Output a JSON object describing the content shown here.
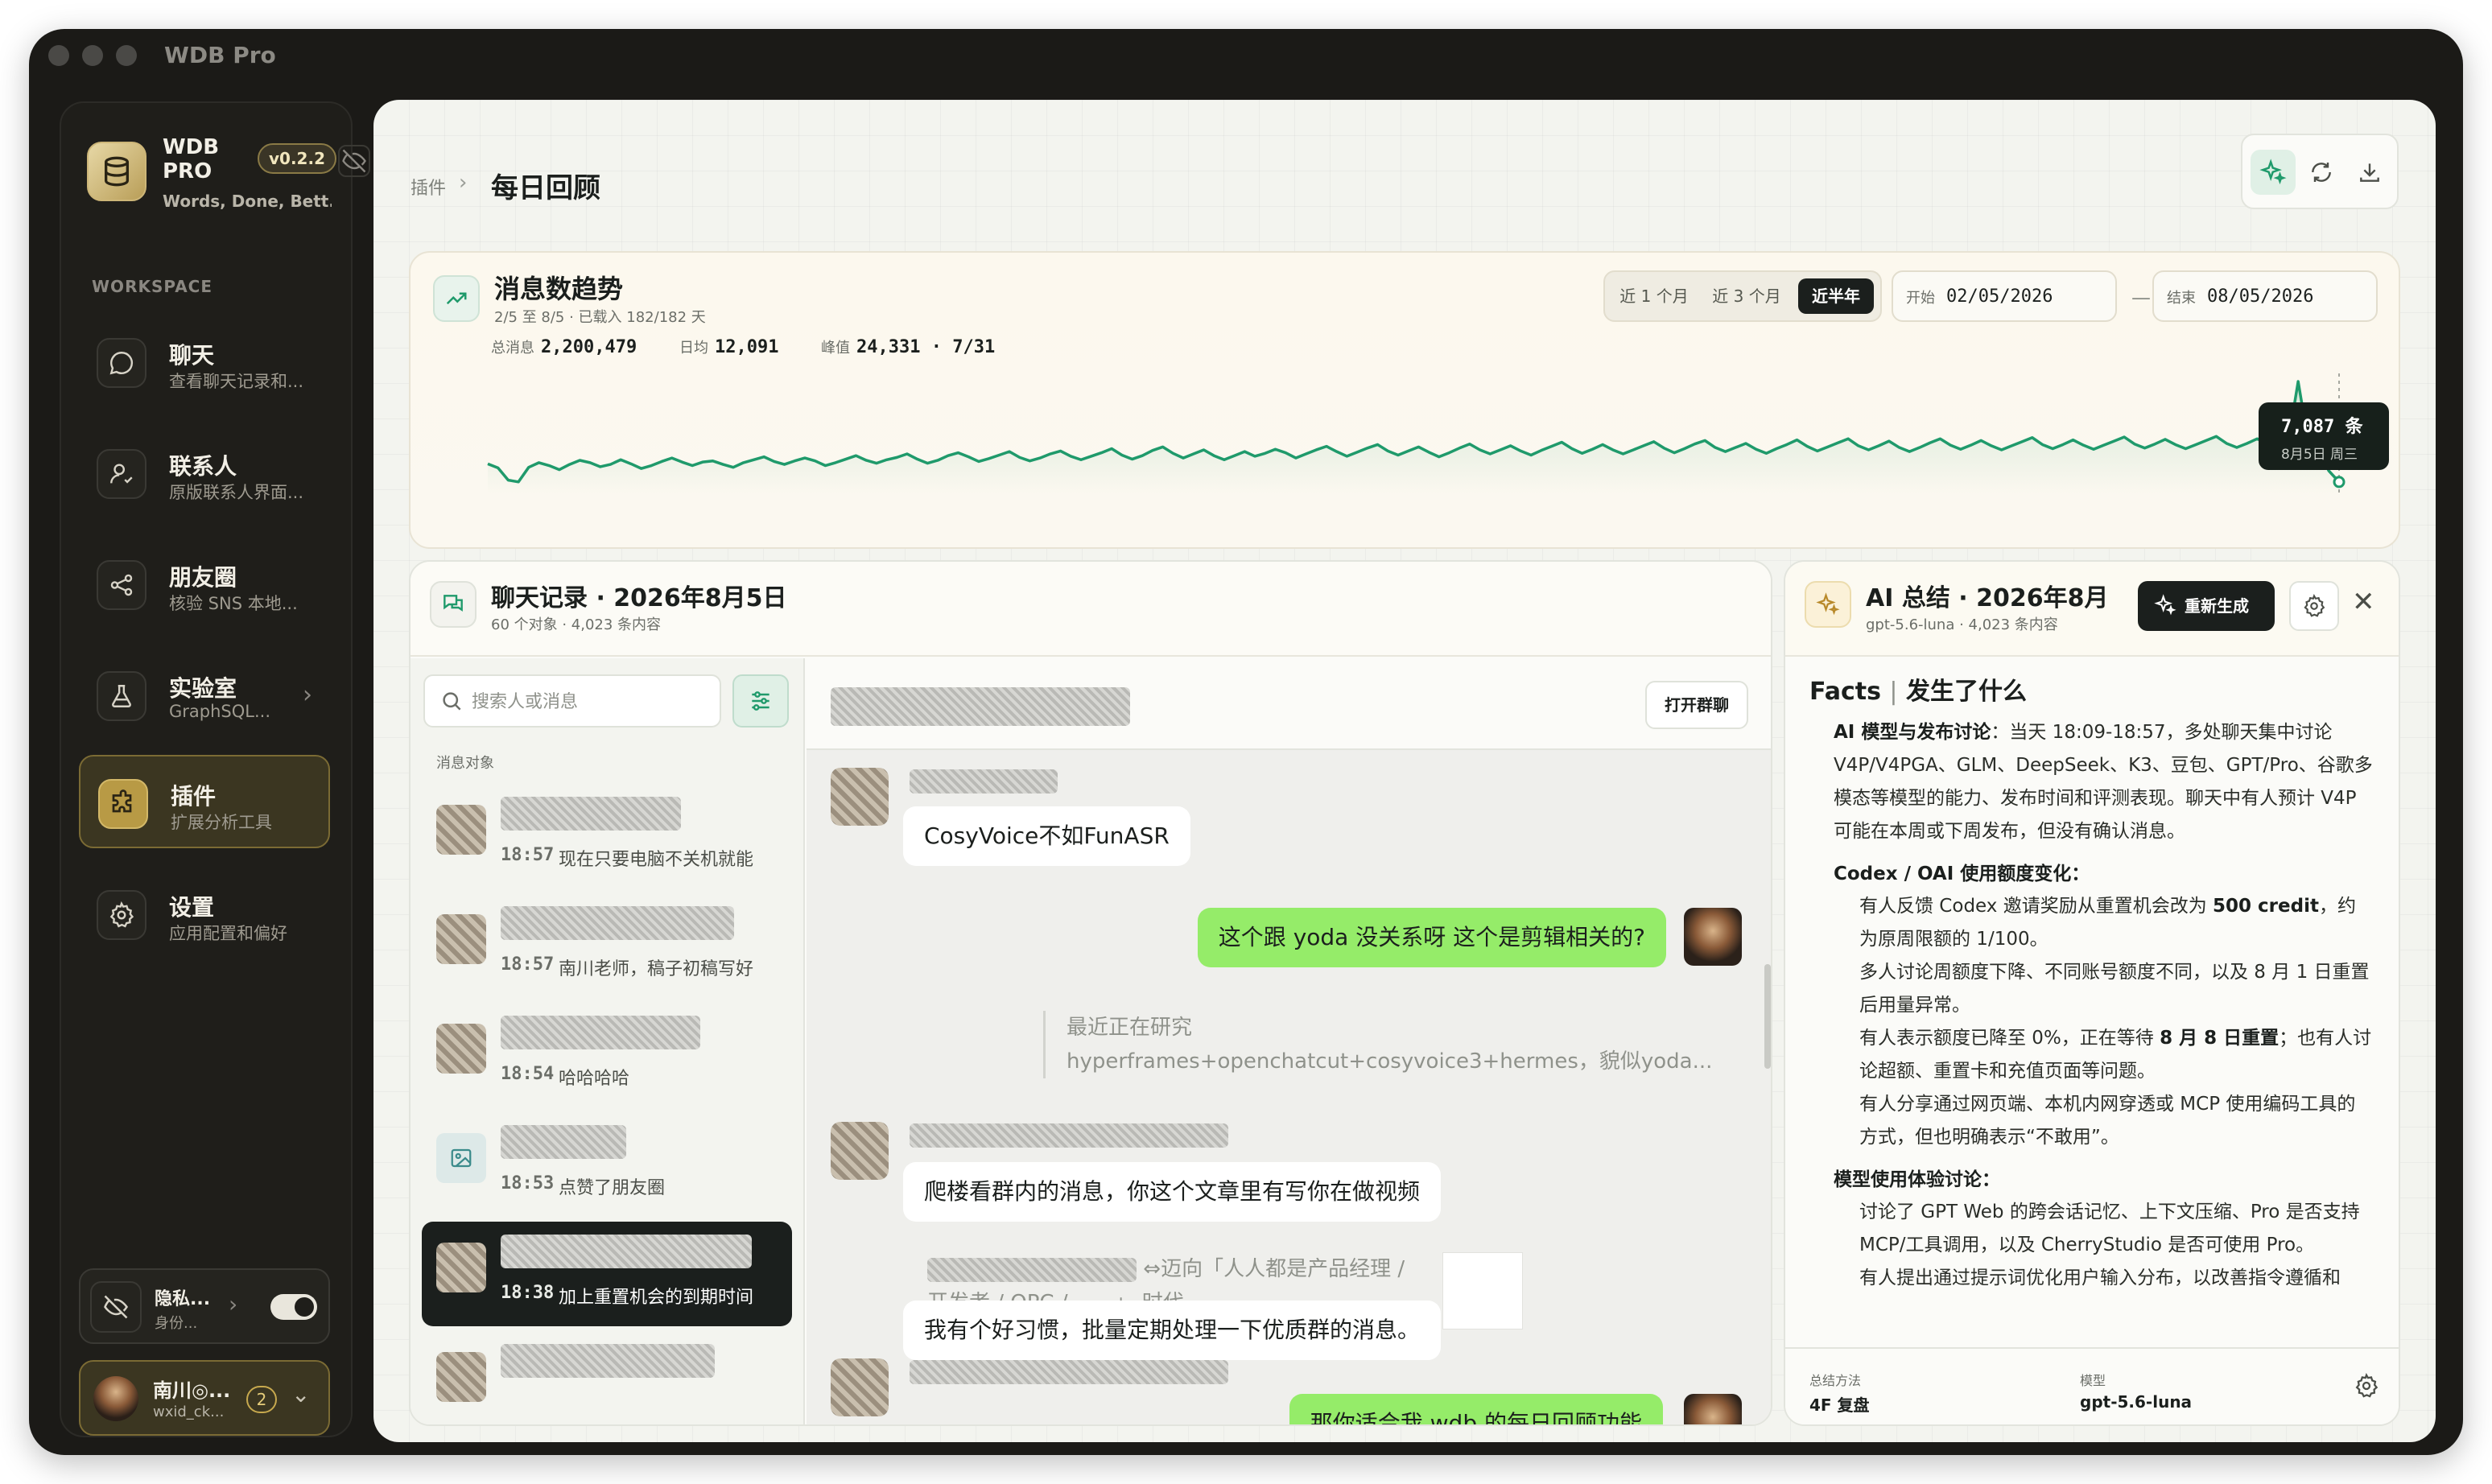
{
  "window": {
    "title": "WDB Pro"
  },
  "brand": {
    "name": "WDB PRO",
    "version": "v0.2.2",
    "slogan": "Words, Done, Bett..."
  },
  "sidebar": {
    "section_label": "WORKSPACE",
    "items": [
      {
        "title": "聊天",
        "subtitle": "查看聊天记录和...",
        "icon": "chat-icon"
      },
      {
        "title": "联系人",
        "subtitle": "原版联系人界面...",
        "icon": "user-icon"
      },
      {
        "title": "朋友圈",
        "subtitle": "核验 SNS 本地...",
        "icon": "share-icon"
      },
      {
        "title": "实验室",
        "subtitle": "GraphSQL...",
        "icon": "flask-icon"
      },
      {
        "title": "插件",
        "subtitle": "扩展分析工具",
        "icon": "puzzle-icon"
      },
      {
        "title": "设置",
        "subtitle": "应用配置和偏好",
        "icon": "gear-icon"
      }
    ],
    "privacy": {
      "title": "隐私...",
      "subtitle": "身份..."
    },
    "account": {
      "name": "南川◎...",
      "id": "wxid_ck...",
      "badge": "2"
    }
  },
  "breadcrumb": {
    "parent": "插件",
    "current": "每日回顾"
  },
  "trend": {
    "title": "消息数趋势",
    "subtitle": "2/5 至 8/5 · 已载入 182/182 天",
    "stats": [
      {
        "label": "总消息",
        "value": "2,200,479"
      },
      {
        "label": "日均",
        "value": "12,091"
      },
      {
        "label": "峰值",
        "value": "24,331 · 7/31"
      }
    ],
    "ranges": [
      "近 1 个月",
      "近 3 个月",
      "近半年"
    ],
    "range_active": "近半年",
    "start_label": "开始",
    "start_value": "02/05/2026",
    "end_label": "结束",
    "end_value": "08/05/2026",
    "tooltip_value": "7,087 条",
    "tooltip_date": "8月5日 周三"
  },
  "chart_data": {
    "type": "line",
    "title": "消息数趋势",
    "x_start": "2026-02-05",
    "x_end": "2026-08-05",
    "color": "#1f9a6b",
    "values": [
      10200,
      9500,
      7400,
      7100,
      9600,
      10400,
      9900,
      9200,
      10100,
      10800,
      10400,
      9700,
      10100,
      10900,
      10200,
      9400,
      9900,
      10600,
      11200,
      10500,
      9900,
      10500,
      10700,
      10100,
      9600,
      10400,
      10900,
      11400,
      10600,
      10100,
      10700,
      11200,
      10700,
      9900,
      10400,
      11000,
      11600,
      10800,
      10300,
      10900,
      11300,
      11900,
      11000,
      10300,
      10800,
      11600,
      12100,
      11400,
      10600,
      11100,
      11700,
      12300,
      11300,
      10700,
      11200,
      11900,
      12400,
      11500,
      10900,
      11500,
      12100,
      12800,
      11700,
      11000,
      11600,
      12500,
      13100,
      12000,
      11200,
      11900,
      12600,
      11600,
      10900,
      11600,
      12300,
      11500,
      12000,
      12700,
      12100,
      11200,
      11900,
      12600,
      13200,
      12300,
      11500,
      12200,
      12900,
      13500,
      12400,
      11700,
      12400,
      13100,
      12200,
      11400,
      12100,
      12900,
      13600,
      12600,
      11900,
      12600,
      13300,
      12400,
      11700,
      12500,
      13200,
      13900,
      12800,
      12000,
      12700,
      13500,
      12600,
      11900,
      12600,
      13300,
      14000,
      12900,
      12100,
      12800,
      13600,
      14200,
      13000,
      12300,
      13000,
      13700,
      12700,
      12000,
      12800,
      13500,
      14300,
      13200,
      12400,
      13100,
      13800,
      14500,
      13300,
      12600,
      13300,
      14100,
      13000,
      12300,
      13000,
      13800,
      14500,
      13400,
      12700,
      13400,
      14200,
      13300,
      12600,
      13300,
      14000,
      14700,
      13500,
      12800,
      13500,
      14300,
      13400,
      12700,
      13400,
      14100,
      14800,
      13600,
      12900,
      13600,
      14400,
      13500,
      12800,
      13500,
      14200,
      14900,
      13700,
      13000,
      13700,
      14500,
      13600,
      12900,
      13600,
      24331,
      13800,
      12500,
      9000,
      7087
    ]
  },
  "chat": {
    "title": "聊天记录 · 2026年8月5日",
    "subtitle": "60 个对象 · 4,023 条内容",
    "search_placeholder": "搜索人或消息",
    "list_label": "消息对象",
    "open_group": "打开群聊",
    "conversations": [
      {
        "time": "18:57",
        "preview": "现在只要电脑不关机就能"
      },
      {
        "time": "18:57",
        "preview": "南川老师，稿子初稿写好"
      },
      {
        "time": "18:54",
        "preview": "哈哈哈哈"
      },
      {
        "time": "18:53",
        "preview": "点赞了朋友圈"
      },
      {
        "time": "18:38",
        "preview": "加上重置机会的到期时间"
      }
    ],
    "messages": {
      "m1": "CosyVoice不如FunASR",
      "m2": "这个跟 yoda 没关系呀 这个是剪辑相关的?",
      "q1": "最近正在研究",
      "q2": "hyperframes+openchatcut+cosyvoice3+hermes，貌似yoda...",
      "m3": "爬楼看群内的消息，你这个文章里有写你在做视频",
      "link1": "迈向「人人都是产品经理 /",
      "link2": "开发者 / OPC / ......」 时代",
      "m4": "我有个好习惯，批量定期处理一下优质群的消息。",
      "m5": "那你适合我 wdb 的每日回顾功能"
    }
  },
  "ai": {
    "title": "AI 总结 · 2026年8月...",
    "subtitle": "gpt-5.6-luna · 4,023 条内容",
    "regen": "重新生成",
    "facts_title": "Facts",
    "facts_sub": "发生了什么",
    "s1_title": "AI 模型与发布讨论",
    "s1_text": "：当天 18:09-18:57，多处聊天集中讨论 V4P/V4PGA、GLM、DeepSeek、K3、豆包、GPT/Pro、谷歌多模态等模型的能力、发布时间和评测表现。聊天中有人预计 V4P 可能在本周或下周发布，但没有确认消息。",
    "s2_title": "Codex / OAI 使用额度变化",
    "s2_colon": "：",
    "s2_p1a": "有人反馈 Codex 邀请奖励从重置机会改为 ",
    "s2_p1b": "500 credit",
    "s2_p1c": "，约为原周限额的 1/100。",
    "s2_p2": "多人讨论周额度下降、不同账号额度不同，以及 8 月 1 日重置后用量异常。",
    "s2_p3a": "有人表示额度已降至 0%，正在等待 ",
    "s2_p3b": "8 月 8 日重置",
    "s2_p3c": "；也有人讨论超额、重置卡和充值页面等问题。",
    "s2_p4": "有人分享通过网页端、本机内网穿透或 MCP 使用编码工具的方式，但也明确表示“不敢用”。",
    "s3_title": "模型使用体验讨论",
    "s3_colon": "：",
    "s3_p1": "讨论了 GPT Web 的跨会话记忆、上下文压缩、Pro 是否支持 MCP/工具调用，以及 CherryStudio 是否可使用 Pro。",
    "s3_p2": "有人提出通过提示词优化用户输入分布，以改善指令遵循和",
    "method_label": "总结方法",
    "method_value": "4F 复盘",
    "model_label": "模型",
    "model_value": "gpt-5.6-luna"
  }
}
